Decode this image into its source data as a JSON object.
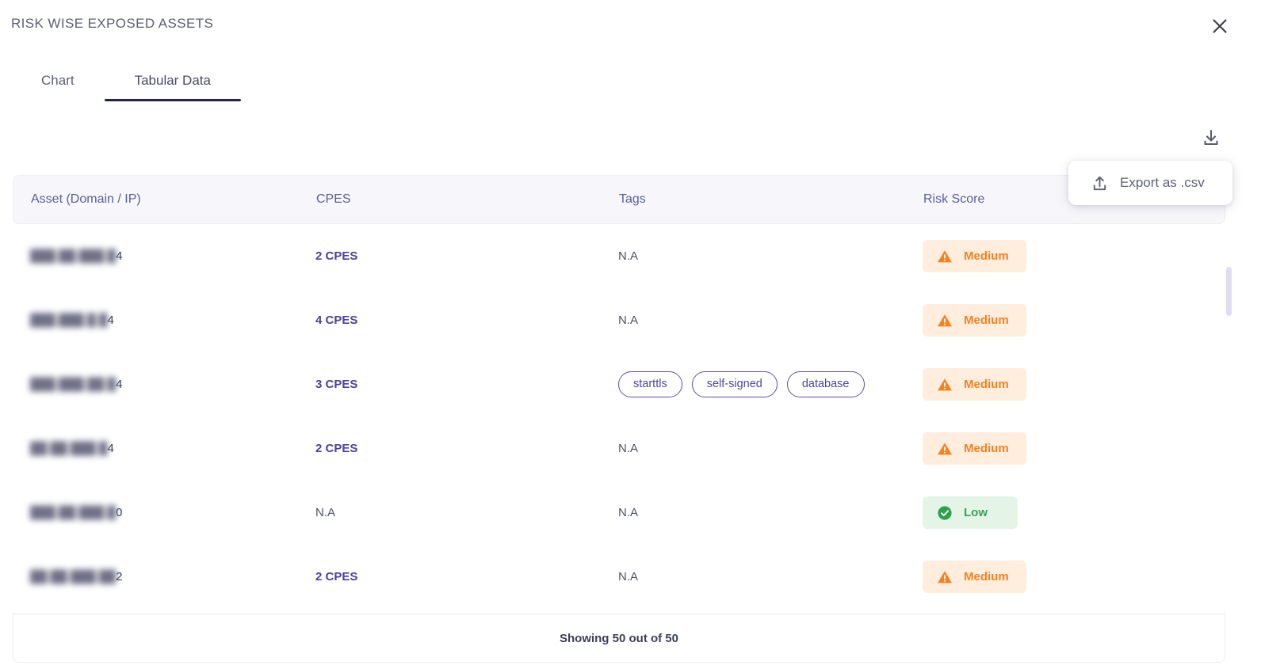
{
  "panel": {
    "title": "RISK WISE EXPOSED ASSETS",
    "close_icon": "close-icon"
  },
  "tabs": [
    {
      "label": "Chart",
      "active": false
    },
    {
      "label": "Tabular Data",
      "active": true
    }
  ],
  "toolbar": {
    "download_icon": "download-icon",
    "export_menu": {
      "icon": "upload-export-icon",
      "label": "Export as .csv"
    }
  },
  "table": {
    "columns": [
      "Asset (Domain / IP)",
      "CPES",
      "Tags",
      "Risk Score"
    ],
    "rows": [
      {
        "asset_masked": "███.██.███.█",
        "asset_visible": "4",
        "cpes": "2 CPES",
        "cpes_link": true,
        "tags": [],
        "tags_empty_label": "N.A",
        "risk": "Medium",
        "risk_level": "medium"
      },
      {
        "asset_masked": "███.███.█.█",
        "asset_visible": "4",
        "cpes": "4 CPES",
        "cpes_link": true,
        "tags": [],
        "tags_empty_label": "N.A",
        "risk": "Medium",
        "risk_level": "medium"
      },
      {
        "asset_masked": "███.███.██.█",
        "asset_visible": "4",
        "cpes": "3 CPES",
        "cpes_link": true,
        "tags": [
          "starttls",
          "self-signed",
          "database"
        ],
        "tags_empty_label": "",
        "risk": "Medium",
        "risk_level": "medium"
      },
      {
        "asset_masked": "██.██.███.█",
        "asset_visible": "4",
        "cpes": "2 CPES",
        "cpes_link": true,
        "tags": [],
        "tags_empty_label": "N.A",
        "risk": "Medium",
        "risk_level": "medium"
      },
      {
        "asset_masked": "███.██.███.█",
        "asset_visible": "0",
        "cpes": "N.A",
        "cpes_link": false,
        "tags": [],
        "tags_empty_label": "N.A",
        "risk": "Low",
        "risk_level": "low"
      },
      {
        "asset_masked": "██.██.███.██",
        "asset_visible": "2",
        "cpes": "2 CPES",
        "cpes_link": true,
        "tags": [],
        "tags_empty_label": "N.A",
        "risk": "Medium",
        "risk_level": "medium"
      }
    ],
    "footer": "Showing 50 out of 50"
  },
  "colors": {
    "accent_purple": "#4b3f9e",
    "header_text": "#5a5e9a",
    "medium_bg": "#ffeedd",
    "medium_fg": "#f58220",
    "low_bg": "#e4f5e8",
    "low_fg": "#36a355",
    "tab_underline": "#21254b",
    "table_header_bg": "#f7f7fb"
  }
}
